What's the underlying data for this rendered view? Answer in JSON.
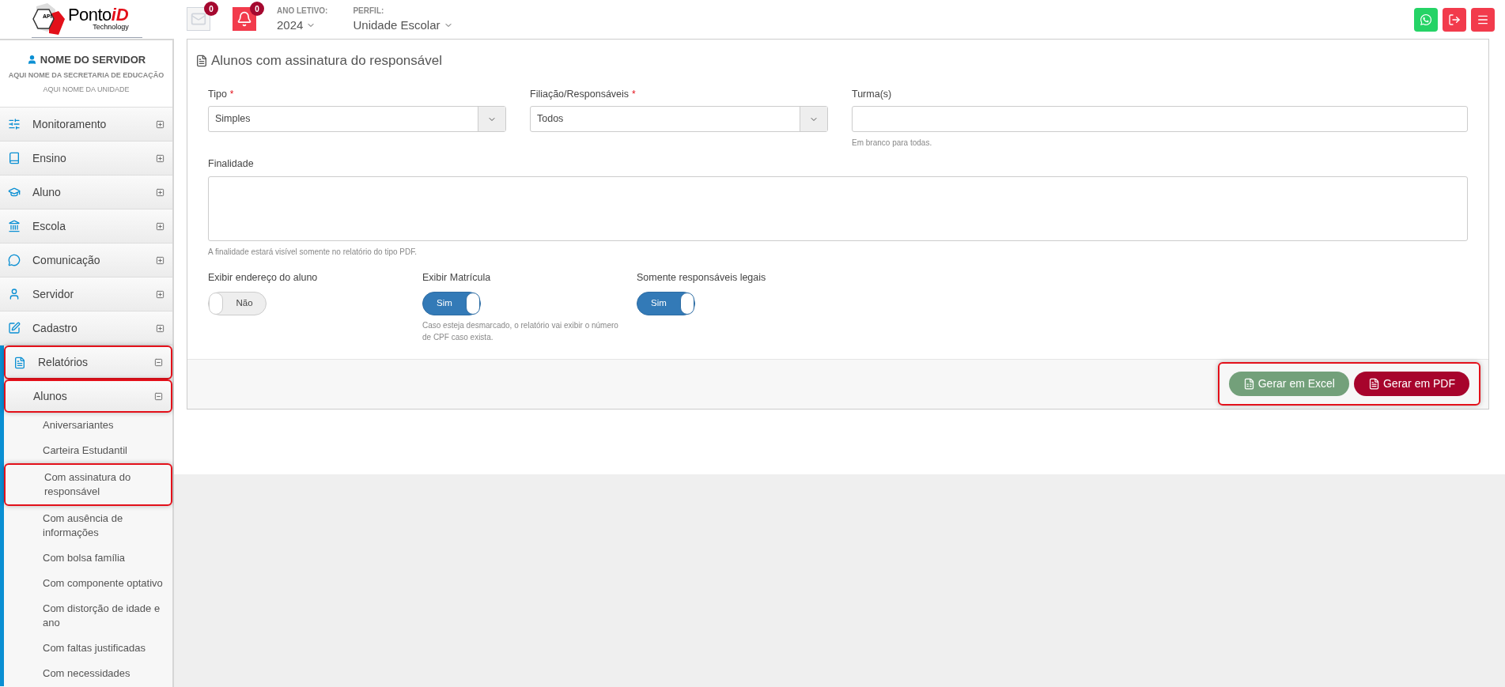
{
  "logo": {
    "badge": "API",
    "brand": "Ponto",
    "brand_accent": "iD",
    "tagline": "Technology"
  },
  "header": {
    "messages": {
      "count": "0"
    },
    "notifications": {
      "count": "0"
    },
    "year": {
      "label": "ANO LETIVO:",
      "value": "2024"
    },
    "profile": {
      "label": "PERFIL:",
      "value": "Unidade Escolar"
    },
    "actions": [
      {
        "kind": "whatsapp"
      },
      {
        "kind": "logout"
      },
      {
        "kind": "menu"
      }
    ]
  },
  "user": {
    "name": "NOME DO SERVIDOR",
    "secretariat": "AQUI NOME DA SECRETARIA DE EDUCAÇÃO",
    "unit": "AQUI NOME DA UNIDADE"
  },
  "menu": [
    {
      "label": "Monitoramento",
      "expanded": false,
      "highlighted": false
    },
    {
      "label": "Ensino",
      "expanded": false,
      "highlighted": false
    },
    {
      "label": "Aluno",
      "expanded": false,
      "highlighted": false
    },
    {
      "label": "Escola",
      "expanded": false,
      "highlighted": false
    },
    {
      "label": "Comunicação",
      "expanded": false,
      "highlighted": false
    },
    {
      "label": "Servidor",
      "expanded": false,
      "highlighted": false
    },
    {
      "label": "Cadastro",
      "expanded": false,
      "highlighted": false
    },
    {
      "label": "Relatórios",
      "expanded": true,
      "highlighted": true,
      "children": [
        {
          "label": "Alunos",
          "expanded": true,
          "highlighted": true,
          "children": [
            {
              "label": "Aniversariantes",
              "highlighted": false
            },
            {
              "label": "Carteira Estudantil",
              "highlighted": false
            },
            {
              "label": "Com assinatura do responsável",
              "highlighted": true
            },
            {
              "label": "Com ausência de informações",
              "highlighted": false
            },
            {
              "label": "Com bolsa família",
              "highlighted": false
            },
            {
              "label": "Com componente optativo",
              "highlighted": false
            },
            {
              "label": "Com distorção de idade e ano",
              "highlighted": false
            },
            {
              "label": "Com faltas justificadas",
              "highlighted": false
            },
            {
              "label": "Com necessidades",
              "highlighted": false
            }
          ]
        }
      ]
    }
  ],
  "form": {
    "title": "Alunos com assinatura do responsável",
    "fields": [
      {
        "kind": "select",
        "label": "Tipo",
        "required_mark": "*",
        "value": "Simples"
      },
      {
        "kind": "select",
        "label": "Filiação/Responsáveis",
        "required_mark": "*",
        "value": "Todos"
      },
      {
        "kind": "text",
        "label": "Turma(s)",
        "help": "Em branco para todas."
      }
    ],
    "purpose": {
      "label": "Finalidade",
      "help": "A finalidade estará visível somente no relatório do tipo PDF."
    },
    "toggles": [
      {
        "label": "Exibir endereço do aluno",
        "on": false,
        "state_text": "Não"
      },
      {
        "label": "Exibir Matrícula",
        "on": true,
        "state_text": "Sim",
        "help": "Caso esteja desmarcado, o relatório vai exibir o número de CPF caso exista."
      },
      {
        "label": "Somente responsáveis legais",
        "on": true,
        "state_text": "Sim"
      }
    ],
    "actions_highlighted": true,
    "buttons": [
      {
        "kind": "excel",
        "label": "Gerar em Excel"
      },
      {
        "kind": "pdf",
        "label": "Gerar em PDF"
      }
    ]
  }
}
